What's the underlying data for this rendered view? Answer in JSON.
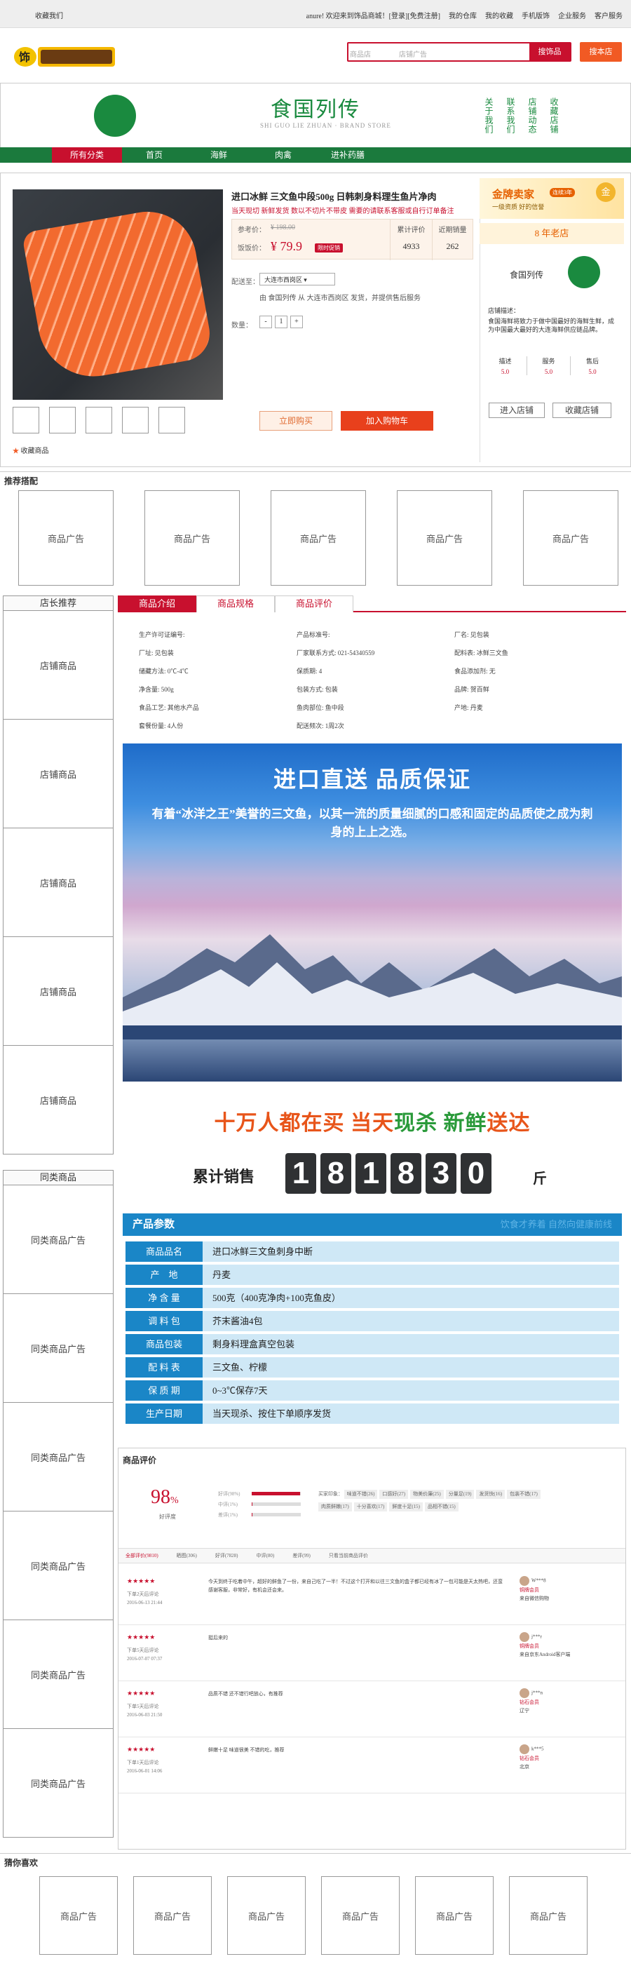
{
  "topbar": {
    "left": "收藏我们",
    "right": [
      "anure! 欢迎来到饰品商城！[登录][免费注册]",
      "我的仓库",
      "我的收藏",
      "手机版饰",
      "企业服务",
      "客户服务"
    ]
  },
  "search": {
    "tab1": "商品店",
    "tab2": "店铺广告",
    "button": "搜饰品",
    "store_button": "搜本店"
  },
  "banner": {
    "title": "食国列传",
    "subtitle": "SHI GUO LIE ZHUAN · BRAND STORE",
    "vtabs": [
      "关于我们",
      "联系我们",
      "店铺动态",
      "收藏店铺"
    ]
  },
  "nav": [
    "所有分类",
    "首页",
    "海鲜",
    "肉禽",
    "进补药膳"
  ],
  "product": {
    "title": "进口冰鲜 三文鱼中段500g 日韩刺身料理生鱼片净肉",
    "desc": "当天现切 新鲜发货 数以不切片不带皮 需要的请联系客服或自行订单备注",
    "ref_label": "参考价：",
    "ref_price": "¥ 198.00",
    "price_label": "饭饭价：",
    "price": "¥ 79.9",
    "promo": "限时促销",
    "cum_label": "累计评价",
    "cum_value": "4933",
    "month_label": "近期销量",
    "month_value": "262",
    "ship_label": "配送至：",
    "ship_select": "大连市西岗区 ▾",
    "ship_info": "由 食国列传 从 大连市西岗区 发货，并提供售后服务",
    "qty_label": "数量：",
    "qty_minus": "-",
    "qty_value": "1",
    "qty_plus": "+",
    "buy": "立即购买",
    "cart": "加入购物车",
    "fav": "收藏商品"
  },
  "shop": {
    "gold": "金牌卖家",
    "gold_tag": "连续3年",
    "gold_sub": "一级资质 好的信誉",
    "medal": "金",
    "years": "8 年老店",
    "name": "食国列传",
    "desc_label": "店铺描述：",
    "desc": "食国海鲜将致力于做中国最好的海鲜生鲜，成为中国最大最好的大连海鲜供应链品牌。",
    "scores": [
      {
        "k": "描述",
        "v": "5.0"
      },
      {
        "k": "服务",
        "v": "5.0"
      },
      {
        "k": "售后",
        "v": "5.0"
      }
    ],
    "enter": "进入店铺",
    "collect": "收藏店铺"
  },
  "recommend": {
    "title": "推荐搭配",
    "ads": [
      "商品广告",
      "商品广告",
      "商品广告",
      "商品广告",
      "商品广告"
    ]
  },
  "sidebar": {
    "shop_title": "店长推荐",
    "shop_items": [
      "店铺商品",
      "店铺商品",
      "店铺商品",
      "店铺商品",
      "店铺商品"
    ],
    "similar_title": "同类商品",
    "similar_items": [
      "同类商品广告",
      "同类商品广告",
      "同类商品广告",
      "同类商品广告",
      "同类商品广告",
      "同类商品广告"
    ]
  },
  "tabs": [
    "商品介绍",
    "商品规格",
    "商品评价"
  ],
  "attrs": [
    "生产许可证编号:",
    "产品标准号:",
    "厂名: 见包装",
    "厂址: 见包装",
    "厂家联系方式: 021-54340559",
    "配料表: 冰鲜三文鱼",
    "储藏方法: 0℃-4℃",
    "保质期: 4",
    "食品添加剂: 无",
    "净含量: 500g",
    "包装方式: 包装",
    "品牌: 贺百鲜",
    "食品工艺: 其他水产品",
    "鱼肉部位: 鱼中段",
    "产地: 丹麦",
    "套餐份量: 4人份",
    "配送频次: 1周2次",
    ""
  ],
  "hero": {
    "headline": "进口直送 品质保证",
    "text": "有着“冰洋之王”美誉的三文鱼，以其一流的质量细腻的口感和固定的品质使之成为刺身的上上之选。"
  },
  "sales": {
    "headline_a": "十万人都在买 当天",
    "headline_b": "现杀",
    "headline_c": " 新鲜",
    "headline_d": "送达",
    "label": "累计销售",
    "digits": [
      "1",
      "8",
      "1",
      "8",
      "3",
      "0"
    ],
    "unit": "斤"
  },
  "params": {
    "title": "产品参数",
    "ghost": "饮食才养着 自然向健康前线",
    "rows": [
      {
        "k": "商品品名",
        "v": "进口冰鲜三文鱼刺身中断"
      },
      {
        "k": "产　地",
        "v": "丹麦"
      },
      {
        "k": "净 含 量",
        "v": "500克（400克净肉+100克鱼皮）"
      },
      {
        "k": "调 料 包",
        "v": "芥末酱油4包"
      },
      {
        "k": "商品包装",
        "v": "剩身料理盒真空包装"
      },
      {
        "k": "配 料 表",
        "v": "三文鱼、柠檬"
      },
      {
        "k": "保 质 期",
        "v": "0~3℃保存7天"
      },
      {
        "k": "生产日期",
        "v": "当天现杀、按住下单顺序发货"
      }
    ]
  },
  "reviews": {
    "title": "商品评价",
    "rate": "98",
    "rate_unit": "%",
    "rate_label": "好评度",
    "bars": [
      {
        "k": "好评(98%)",
        "p": 98
      },
      {
        "k": "中评(1%)",
        "p": 1
      },
      {
        "k": "差评(1%)",
        "p": 1
      }
    ],
    "tags_label": "买家印象：",
    "tags": [
      "味道不错(26)",
      "口感好(27)",
      "物美价廉(25)",
      "分量足(19)",
      "发货快(16)",
      "包装不错(17)",
      "肉质鲜嫩(17)",
      "十分喜欢(17)",
      "鲜度十足(15)",
      "品相不错(15)"
    ],
    "tabs": [
      "全部评价(9810)",
      "晒图(306)",
      "好评(7828)",
      "中评(80)",
      "差评(99)",
      "只看当前商品评价"
    ],
    "items": [
      {
        "stars": "★★★★★",
        "meta1": "下单2天后评论",
        "meta2": "2016-06-13 21:44",
        "text": "今天到终于吃着中午，超好的鲜鱼了一份，来自己吃了一半！不过这个打开和以往三文鱼的盒子都已经有冰了一包可能是天太热吧，还蛮感谢客服，非常好，有机会还会来。",
        "user": "W***8",
        "lvl": "铜牌会员",
        "loc": "来自微信购物"
      },
      {
        "stars": "★★★★★",
        "meta1": "下单5天后评论",
        "meta2": "2016-07-07 07:37",
        "text": "挺后来的",
        "user": "j***r",
        "lvl": "铜牌会员",
        "loc": "来自京东Android客户端"
      },
      {
        "stars": "★★★★★",
        "meta1": "下单5天后评论",
        "meta2": "2016-06-03 21:50",
        "text": "品质不错 还不错行吧放心，有推荐",
        "user": "j***n",
        "lvl": "钻石会员",
        "loc": "辽宁"
      },
      {
        "stars": "★★★★★",
        "meta1": "下单1天后评论",
        "meta2": "2016-06-01 14:06",
        "text": "鲜嫩十足 味道很美 不错的吃，推荐",
        "user": "k***5",
        "lvl": "钻石会员",
        "loc": "北京"
      }
    ]
  },
  "like": {
    "title": "猜你喜欢",
    "ads": [
      "商品广告",
      "商品广告",
      "商品广告",
      "商品广告",
      "商品广告",
      "商品广告"
    ]
  },
  "colors": {
    "brand_red": "#c8102e",
    "brand_green": "#1a8a3f",
    "param_blue": "#1a86c7"
  }
}
